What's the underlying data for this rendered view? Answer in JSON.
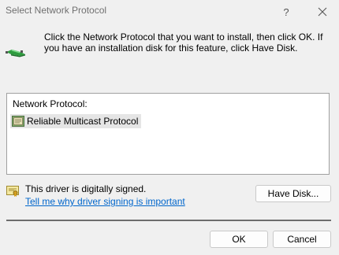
{
  "window": {
    "title": "Select Network Protocol",
    "help_glyph": "?",
    "close_icon": "close-icon"
  },
  "intro": {
    "icon": "network-protocol-icon",
    "text": "Click the Network Protocol that you want to install, then click OK. If you have an installation disk for this feature, click Have Disk."
  },
  "list": {
    "header": "Network Protocol:",
    "items": [
      {
        "icon": "protocol-icon",
        "label": "Reliable Multicast Protocol",
        "selected": true
      }
    ]
  },
  "signing": {
    "icon": "certificate-icon",
    "status": "This driver is digitally signed.",
    "link": "Tell me why driver signing is important"
  },
  "buttons": {
    "have_disk": "Have Disk...",
    "ok": "OK",
    "cancel": "Cancel"
  },
  "colors": {
    "background": "#f0f0f0",
    "link": "#0066cc",
    "selection": "#e5e5e5",
    "title_text": "#707070"
  }
}
